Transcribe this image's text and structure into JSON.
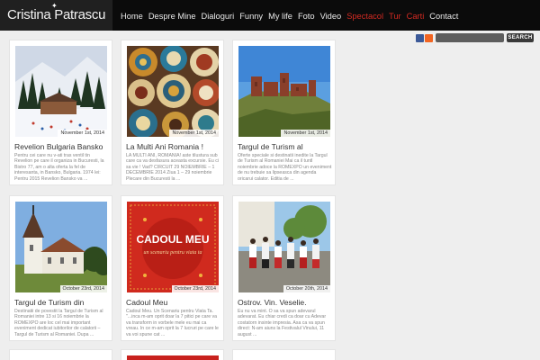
{
  "site": {
    "title": "Cristina Patrascu"
  },
  "nav": [
    {
      "label": "Home",
      "hot": false
    },
    {
      "label": "Despre Mine",
      "hot": false
    },
    {
      "label": "Dialoguri",
      "hot": false
    },
    {
      "label": "Funny",
      "hot": false
    },
    {
      "label": "My life",
      "hot": false
    },
    {
      "label": "Foto",
      "hot": false
    },
    {
      "label": "Video",
      "hot": false
    },
    {
      "label": "Spectacol",
      "hot": true
    },
    {
      "label": "Tur",
      "hot": true
    },
    {
      "label": "Carti",
      "hot": true
    },
    {
      "label": "Contact",
      "hot": false
    }
  ],
  "search": {
    "placeholder": "",
    "button_label": "SEARCH"
  },
  "social_icons": [
    {
      "name": "facebook-icon",
      "color": "#3b5998"
    },
    {
      "name": "rss-icon",
      "color": "#f26522"
    }
  ],
  "colors": {
    "accent": "#d42a22",
    "header_bg": "#0b0b0b"
  },
  "posts": [
    {
      "title": "Revelion Bulgaria Bansko",
      "date": "November 1st, 2014",
      "image": "snow-resort",
      "excerpt": "Pentru cei care nu v-ati tras ventil tin Revelion pe care il organiza in Bucuresti, la Bistro 77, am o alta oferta la fel de interesanta, in Bansko, Bulgaria. 1974 lei: Pentru 2015 Revelion Bansko va ..."
    },
    {
      "title": "La Multi Ani Romania !",
      "date": "November 1st, 2014",
      "image": "painted-plates",
      "excerpt": "LA MULTI ANI, ROMANIA! aste tilustura sub care ca va desfasura aceasta excursie. Eu ci sa vie ! Vad? CIRCUIT 29 NOIEMBRIE – 1 DECEMBRIE 2014 Ziua 1 – 29 noiembrie Plecare din Bucuresti la ..."
    },
    {
      "title": "Targul de Turism al",
      "date": "November 1st, 2014",
      "image": "castle-ruin",
      "excerpt": "Oferte speciale si destinatii inedite la Targul de Turism al Romaniei Mai ca il tuntl noiembrie adoce la ROMEXPO un eveniment de nu trebuie sa lipseasca din agenda oricarui calator. Editia de ..."
    },
    {
      "title": "Targul de Turism din",
      "date": "October 23rd, 2014",
      "image": "church-tower",
      "excerpt": "Destinatii de povestit la Targul de Turism al Romaniei intre 13 si 16 noiembrie la ROMEXPO are loc cel mai important eveniment dedicat iubitorilor de calatorii – Targul de Turism al Romaniei. Dupa ..."
    },
    {
      "title": "Cadoul Meu",
      "date": "October 23rd, 2014",
      "image": "red-gift-card",
      "overlay_title": "CADOUL MEU",
      "overlay_subtitle": "un scenariu pentru viata ta",
      "excerpt": "Cadoul Meu. Un Scenariu pentru Viata Ta. \"...inca m-am oprit doar la 7 pitici pe care va va transform in vorbele mele eu mai ca vreau. In ce m-am oprit la 7 lucruri pe care le va voi spune cat ..."
    },
    {
      "title": "Ostrov. Vin. Veselie.",
      "date": "October 20th, 2014",
      "image": "folk-dance",
      "excerpt": "Eu nu va mint. O sa va spun adevarul adevarat. Eu chiar credi ca doar cu Adevar costatorn insinte impresia. Asa ca va spun direct: N-am aiuns la Festivalul Vinului, 11 august ..."
    }
  ]
}
